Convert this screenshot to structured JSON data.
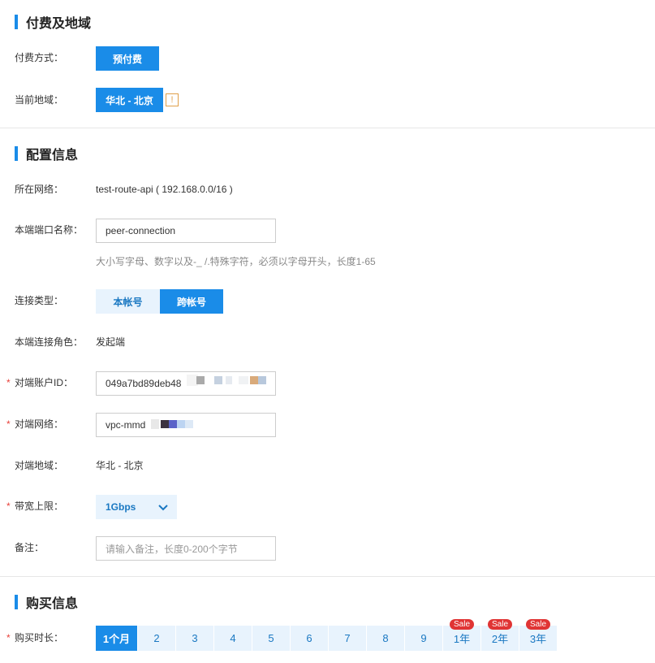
{
  "payment_section": {
    "title": "付费及地域",
    "pay_method_label": "付费方式：",
    "pay_method_value": "预付费",
    "region_label": "当前地域：",
    "region_value": "华北 - 北京",
    "info_icon_glyph": "!"
  },
  "config_section": {
    "title": "配置信息",
    "network_label": "所在网络：",
    "network_value": "test-route-api ( 192.168.0.0/16 )",
    "port_name_label": "本端端口名称：",
    "port_name_value": "peer-connection",
    "port_name_hint": "大小写字母、数字以及-_ /.特殊字符，必须以字母开头，长度1-65",
    "conn_type_label": "连接类型：",
    "conn_type_options": [
      "本帐号",
      "跨帐号"
    ],
    "conn_type_selected": "跨帐号",
    "role_label": "本端连接角色：",
    "role_value": "发起端",
    "peer_account_label": "对端账户ID：",
    "peer_account_value": "049a7bd89deb48",
    "peer_network_label": "对端网络：",
    "peer_network_value": "vpc-mmd",
    "peer_region_label": "对端地域：",
    "peer_region_value": "华北 - 北京",
    "bandwidth_label": "带宽上限：",
    "bandwidth_value": "1Gbps",
    "remark_label": "备注：",
    "remark_placeholder": "请输入备注，长度0-200个字节",
    "required_mark": "*"
  },
  "purchase_section": {
    "title": "购买信息",
    "duration_label": "购买时长：",
    "durations": [
      {
        "label": "1个月",
        "active": true,
        "sale": ""
      },
      {
        "label": "2",
        "active": false,
        "sale": ""
      },
      {
        "label": "3",
        "active": false,
        "sale": ""
      },
      {
        "label": "4",
        "active": false,
        "sale": ""
      },
      {
        "label": "5",
        "active": false,
        "sale": ""
      },
      {
        "label": "6",
        "active": false,
        "sale": ""
      },
      {
        "label": "7",
        "active": false,
        "sale": ""
      },
      {
        "label": "8",
        "active": false,
        "sale": ""
      },
      {
        "label": "9",
        "active": false,
        "sale": ""
      },
      {
        "label": "1年",
        "active": false,
        "sale": "Sale"
      },
      {
        "label": "2年",
        "active": false,
        "sale": "Sale"
      },
      {
        "label": "3年",
        "active": false,
        "sale": "Sale"
      }
    ]
  },
  "colors": {
    "accent": "#1a8ce8",
    "accent_light": "#e8f3fd",
    "sale_red": "#e03434",
    "required_red": "#e8413a"
  }
}
